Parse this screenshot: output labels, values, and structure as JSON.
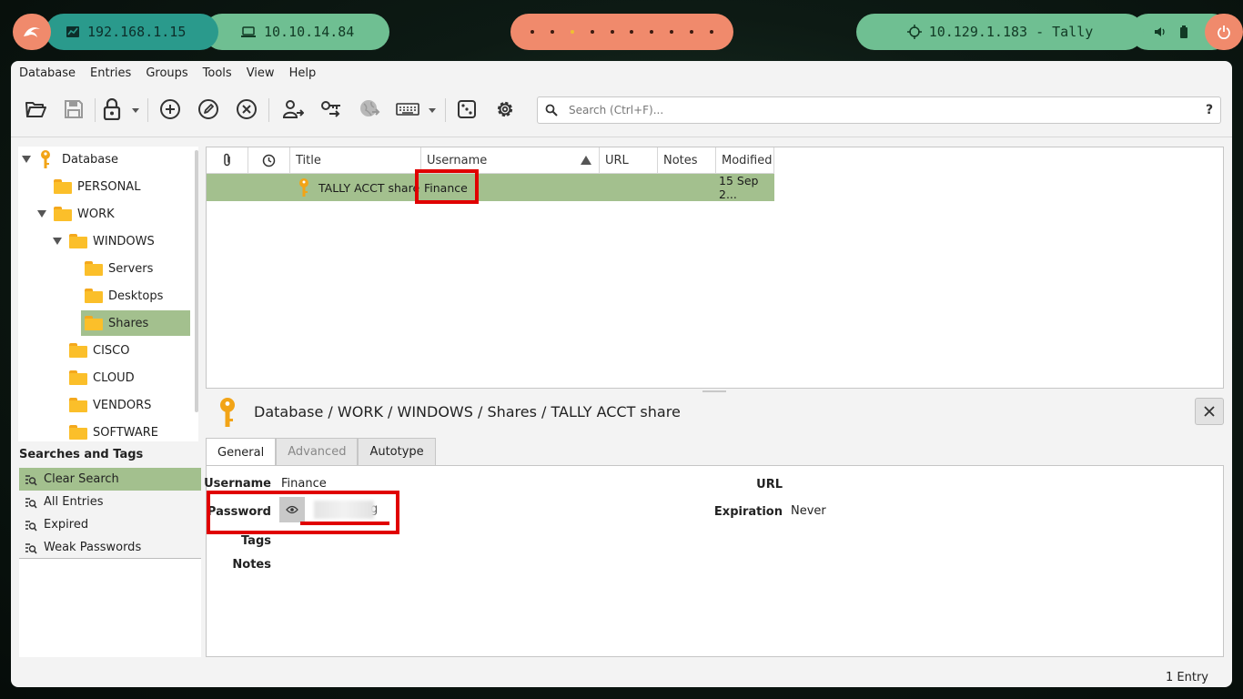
{
  "topbar": {
    "local_ip": "192.168.1.15",
    "vpn_ip": "10.10.14.84",
    "target": "10.129.1.183 - Tally",
    "workspaces": {
      "count": 10,
      "active_index": 2
    },
    "accent_colors": {
      "salmon": "#f08a6c",
      "teal": "#2a9a8c",
      "green": "#6fbf92"
    }
  },
  "menu": [
    "Database",
    "Entries",
    "Groups",
    "Tools",
    "View",
    "Help"
  ],
  "toolbar": {
    "icons": [
      "open-database-icon",
      "save-database-icon",
      "lock-database-icon",
      "add-entry-icon",
      "edit-entry-icon",
      "delete-entry-icon",
      "copy-username-icon",
      "copy-password-icon",
      "open-url-icon",
      "autotype-keyboard-icon",
      "password-generator-icon",
      "settings-icon"
    ],
    "search_placeholder": "Search (Ctrl+F)...",
    "help_label": "?"
  },
  "tree": [
    {
      "label": "Database",
      "expanded": true
    },
    {
      "label": "PERSONAL"
    },
    {
      "label": "WORK",
      "expanded": true
    },
    {
      "label": "WINDOWS",
      "expanded": true
    },
    {
      "label": "Servers"
    },
    {
      "label": "Desktops"
    },
    {
      "label": "Shares",
      "selected": true
    },
    {
      "label": "CISCO"
    },
    {
      "label": "CLOUD"
    },
    {
      "label": "VENDORS"
    },
    {
      "label": "SOFTWARE"
    }
  ],
  "searches_tags": {
    "title": "Searches and Tags",
    "items": [
      "Clear Search",
      "All Entries",
      "Expired",
      "Weak Passwords"
    ],
    "selected": "Clear Search"
  },
  "table": {
    "columns": [
      "",
      "",
      "Title",
      "Username",
      "URL",
      "Notes",
      "Modified"
    ],
    "sorted_by": "Username",
    "rows": [
      {
        "title": "TALLY ACCT share",
        "username": "Finance",
        "url": "",
        "notes": "",
        "modified": "15 Sep 2..."
      }
    ],
    "highlight_color": "#a3c08e"
  },
  "details": {
    "path": "Database / WORK / WINDOWS / Shares / TALLY ACCT share",
    "tabs": [
      "General",
      "Advanced",
      "Autotype"
    ],
    "active_tab": "General",
    "fields": {
      "username_label": "Username",
      "username": "Finance",
      "password_label": "Password",
      "password_visible_tail": "g",
      "tags_label": "Tags",
      "notes_label": "Notes",
      "url_label": "URL",
      "expiration_label": "Expiration",
      "expiration": "Never"
    }
  },
  "status": {
    "entries": "1 Entry"
  },
  "annotation_color": "#e00000"
}
